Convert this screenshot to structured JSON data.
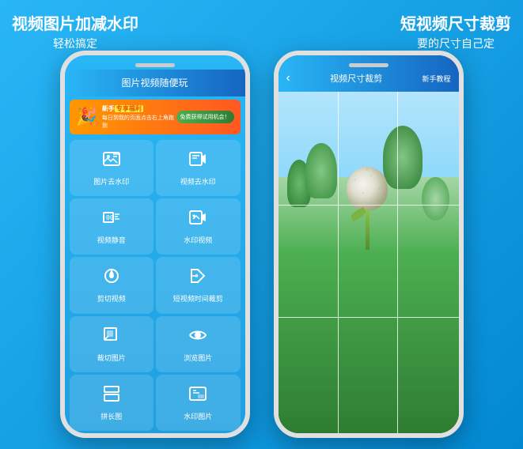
{
  "left": {
    "title": "视频图片加减水印",
    "subtitle": "轻松搞定"
  },
  "right": {
    "title": "短视频尺寸裁剪",
    "subtitle": "要的尺寸自己定"
  },
  "left_phone": {
    "header": "图片视频随便玩",
    "banner": {
      "icon": "🎉",
      "line1_prefix": "新手",
      "line1_highlight": "专享福利",
      "line1_suffix": "",
      "line2": "每日到我的页面点击右上角跑到",
      "button": "免费获得试用机会！"
    },
    "menu_items": [
      {
        "label": "图片去水印",
        "icon": "watermark-photo"
      },
      {
        "label": "视频去水印",
        "icon": "watermark-video"
      },
      {
        "label": "视频静音",
        "icon": "mute-video"
      },
      {
        "label": "水印视频",
        "icon": "add-watermark"
      },
      {
        "label": "剪切视频",
        "icon": "cut-video"
      },
      {
        "label": "短视频时间裁剪",
        "icon": "trim-video"
      },
      {
        "label": "裁切图片",
        "icon": "crop-image"
      },
      {
        "label": "浏览图片",
        "icon": "browse-image"
      },
      {
        "label": "拼长图",
        "icon": "stitch-image"
      },
      {
        "label": "水印图片",
        "icon": "watermark-image"
      }
    ]
  },
  "right_phone": {
    "back": "‹",
    "title": "视频尺寸裁剪",
    "help": "新手教程"
  }
}
